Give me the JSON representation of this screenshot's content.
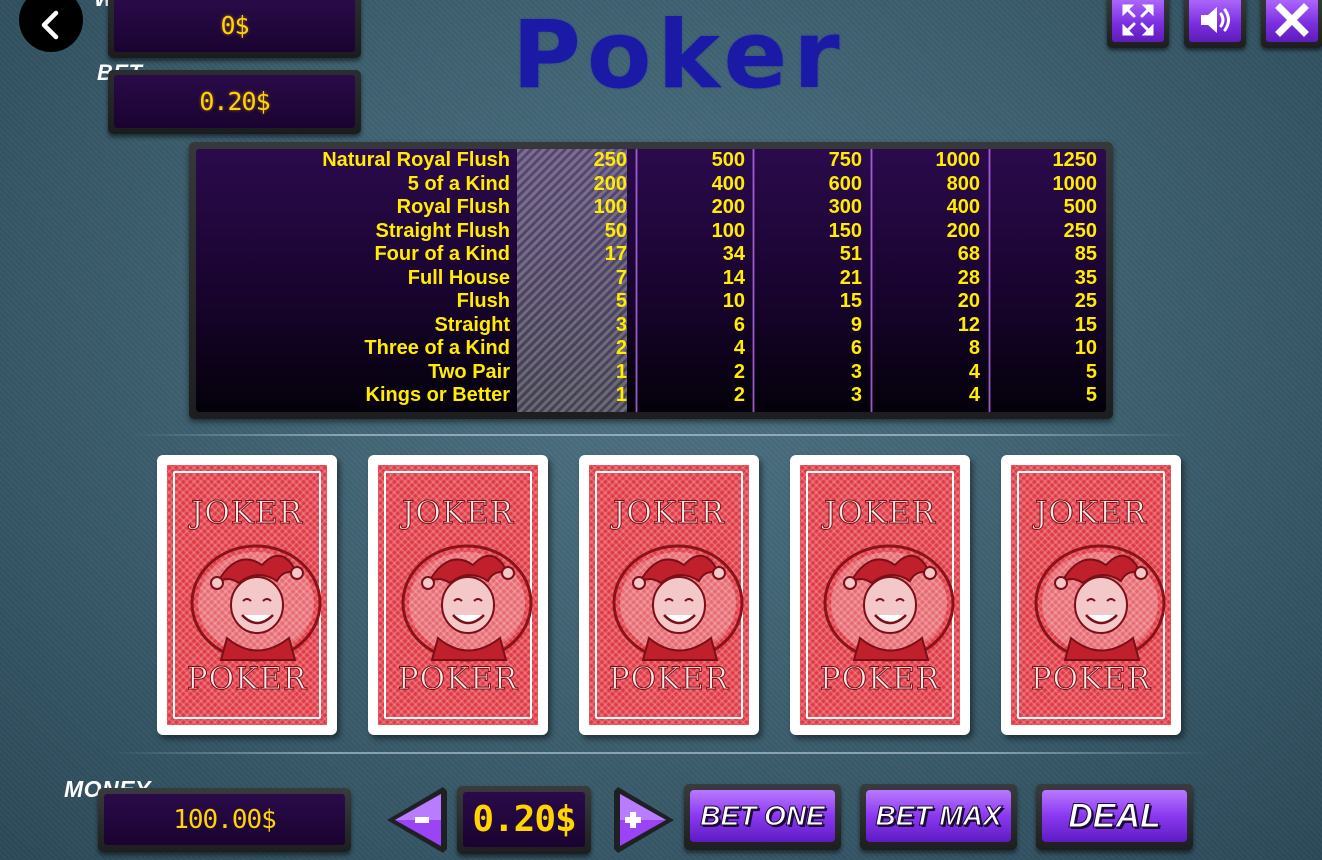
{
  "hud": {
    "win_label": "WIN",
    "win_value": "0$",
    "bet_label": "BET",
    "bet_value": "0.20$",
    "money_label": "MONEY",
    "money_value": "100.00$"
  },
  "title": "Poker",
  "top_buttons": [
    "fullscreen-icon",
    "sound-icon",
    "close-icon"
  ],
  "paytable": {
    "hands": [
      "Natural Royal Flush",
      "5 of a Kind",
      "Royal Flush",
      "Straight Flush",
      "Four of a Kind",
      "Full House",
      "Flush",
      "Straight",
      "Three of a Kind",
      "Two Pair",
      "Kings or Better"
    ],
    "columns": [
      [
        "250",
        "200",
        "100",
        "50",
        "17",
        "7",
        "5",
        "3",
        "2",
        "1",
        "1"
      ],
      [
        "500",
        "400",
        "200",
        "100",
        "34",
        "14",
        "10",
        "6",
        "4",
        "2",
        "2"
      ],
      [
        "750",
        "600",
        "300",
        "150",
        "51",
        "21",
        "15",
        "9",
        "6",
        "3",
        "3"
      ],
      [
        "1000",
        "800",
        "400",
        "200",
        "68",
        "28",
        "20",
        "12",
        "8",
        "4",
        "4"
      ],
      [
        "1250",
        "1000",
        "500",
        "250",
        "85",
        "35",
        "25",
        "15",
        "10",
        "5",
        "5"
      ]
    ],
    "highlighted_column": 1
  },
  "cards": [
    {
      "top": "JOKER",
      "bottom": "POKER"
    },
    {
      "top": "JOKER",
      "bottom": "POKER"
    },
    {
      "top": "JOKER",
      "bottom": "POKER"
    },
    {
      "top": "JOKER",
      "bottom": "POKER"
    },
    {
      "top": "JOKER",
      "bottom": "POKER"
    }
  ],
  "controls": {
    "decrease": "-",
    "coin_value": "0.20$",
    "increase": "+",
    "bet_one": "BET ONE",
    "bet_max": "BET MAX",
    "deal": "DEAL"
  },
  "colors": {
    "paytable_text": "#ffec00",
    "display_text": "#ffd400",
    "button_purple": "#8a38f0",
    "card_red": "#e13a45",
    "title_blue": "#1a1aa6"
  }
}
